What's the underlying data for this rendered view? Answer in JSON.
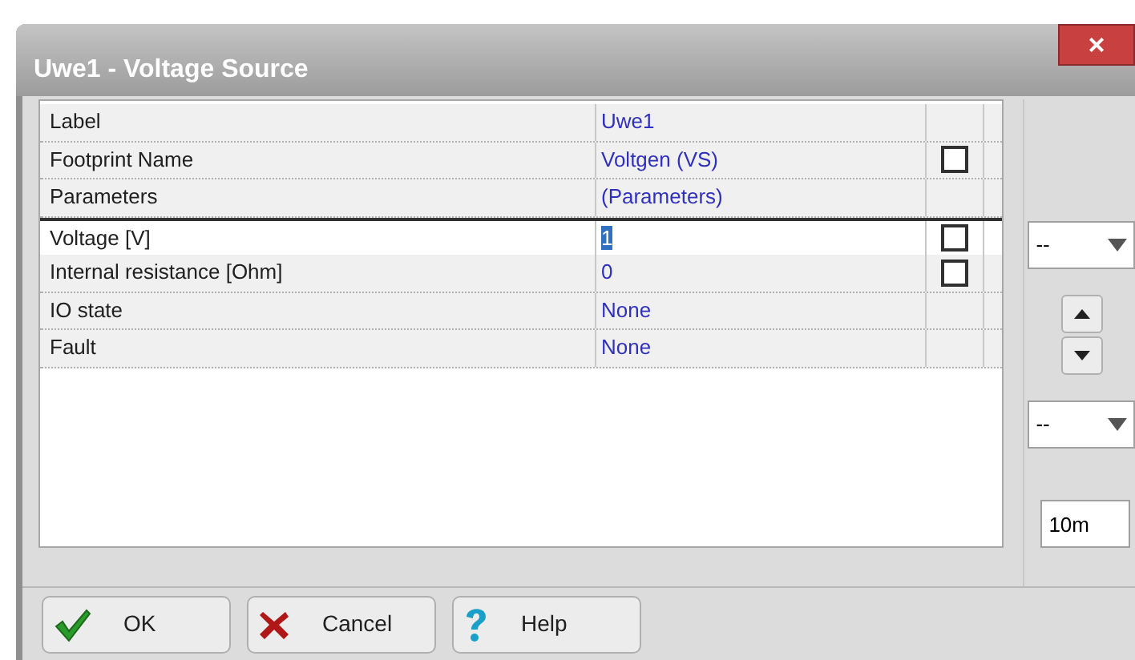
{
  "window": {
    "title": "Uwe1 - Voltage Source",
    "close": "×"
  },
  "rows": [
    {
      "label": "Label",
      "value": "Uwe1",
      "selected": false
    },
    {
      "label": "Footprint Name",
      "value": "Voltgen (VS)",
      "selected": false,
      "checked": false
    },
    {
      "label": "Parameters",
      "value": "(Parameters)",
      "selected": false
    },
    {
      "label": "Voltage [V]",
      "value": "1",
      "selected": true,
      "checked": false
    },
    {
      "label": "Internal resistance [Ohm]",
      "value": "0",
      "selected": false,
      "checked": false
    },
    {
      "label": "IO state",
      "value": "None",
      "selected": false
    },
    {
      "label": "Fault",
      "value": "None",
      "selected": false
    }
  ],
  "side": {
    "combo_1": "--",
    "combo_2": "--",
    "field": "10m"
  },
  "buttons": [
    {
      "kind": "ok",
      "label": "OK"
    },
    {
      "kind": "cancel",
      "label": "Cancel"
    },
    {
      "kind": "help",
      "label": "Help"
    }
  ]
}
